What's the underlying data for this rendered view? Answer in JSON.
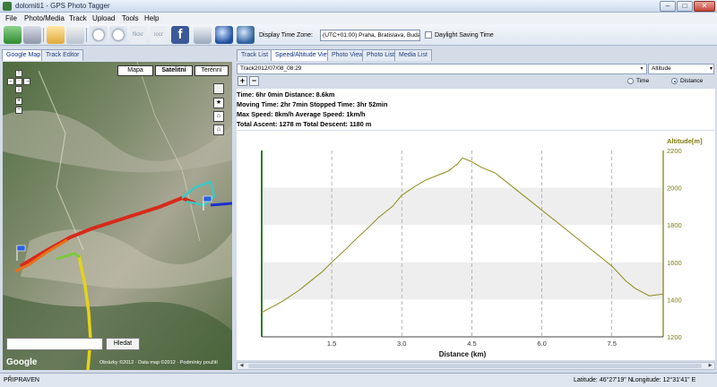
{
  "window": {
    "title": "dolomiti1 - GPS Photo Tagger",
    "minimize": "–",
    "maximize": "□",
    "close": "✕"
  },
  "menu": [
    "File",
    "Photo/Media",
    "Track",
    "Upload",
    "Tools",
    "Help"
  ],
  "toolbar": {
    "icons": [
      "open-track-icon",
      "save-icon",
      "open-folder-icon",
      "photo-edit-icon",
      "clock-icon",
      "time-sync-icon",
      "flickr-icon",
      "locr-icon",
      "facebook-icon",
      "export-icon",
      "google-earth-icon",
      "web-globe-icon"
    ],
    "timezone_label": "Display Time Zone:",
    "timezone_value": "(UTC+01:00) Praha, Bratislava, Buda",
    "dst_label": "Daylight Saving Time"
  },
  "left": {
    "tabs": [
      "Google Map",
      "Track Editor"
    ],
    "map_types": [
      "Mapa",
      "Satelitní",
      "Terénní"
    ],
    "search_button": "Hledat",
    "search_value": "",
    "logo": "Google",
    "footer": "Obrázky ©2012 · Data map ©2012 · Podmínky použití"
  },
  "right": {
    "tabs": [
      "Track List",
      "Speed/Altitude View",
      "Photo View",
      "Photo List",
      "Media List"
    ],
    "track_value": "Track2012/07/08_08:29",
    "metric_value": "Altitude",
    "zoom_in": "+",
    "zoom_out": "−",
    "radio_time": "Time",
    "radio_distance": "Distance",
    "stats": [
      "Time: 6hr 0min  Distance: 8.6km",
      "Moving Time: 2hr 7min  Stopped Time: 3hr 52min",
      "Max Speed: 8km/h  Average Speed: 1km/h",
      "Total Ascent: 1278 m  Total Descent: 1180 m"
    ]
  },
  "status": {
    "text": "PŘIPRAVEN",
    "latitude": "Latitude: 46°27'19\" N",
    "longitude": "Longitude: 12°31'41\" E"
  },
  "colors": {
    "line": "#8c8a1a",
    "axis_label": "#7d7a12",
    "y_axis": "#2f7d2f",
    "grid_band": "#eeeeee"
  },
  "chart_data": {
    "type": "line",
    "xlabel": "Distance (km)",
    "ylabel": "Altitude[m]",
    "xlim": [
      0,
      8.6
    ],
    "ylim": [
      1200,
      2200
    ],
    "xticks": [
      1.5,
      3.0,
      4.5,
      6.0,
      7.5
    ],
    "yticks": [
      1200,
      1400,
      1600,
      1800,
      2000,
      2200
    ],
    "grid": true,
    "series": [
      {
        "x": [
          0.0,
          0.1,
          0.3,
          0.5,
          0.8,
          1.0,
          1.3,
          1.5,
          1.8,
          2.0,
          2.3,
          2.5,
          2.8,
          3.0,
          3.3,
          3.5,
          3.8,
          4.0,
          4.2,
          4.3,
          4.5,
          4.7,
          5.0,
          5.2,
          5.5,
          5.8,
          6.0,
          6.3,
          6.6,
          6.9,
          7.2,
          7.5,
          7.8,
          8.0,
          8.3,
          8.6
        ],
        "y": [
          1330,
          1345,
          1370,
          1400,
          1450,
          1490,
          1550,
          1600,
          1670,
          1720,
          1790,
          1840,
          1900,
          1960,
          2010,
          2040,
          2070,
          2090,
          2130,
          2160,
          2140,
          2110,
          2080,
          2040,
          1980,
          1920,
          1880,
          1820,
          1760,
          1700,
          1640,
          1580,
          1500,
          1460,
          1420,
          1430
        ]
      }
    ]
  }
}
